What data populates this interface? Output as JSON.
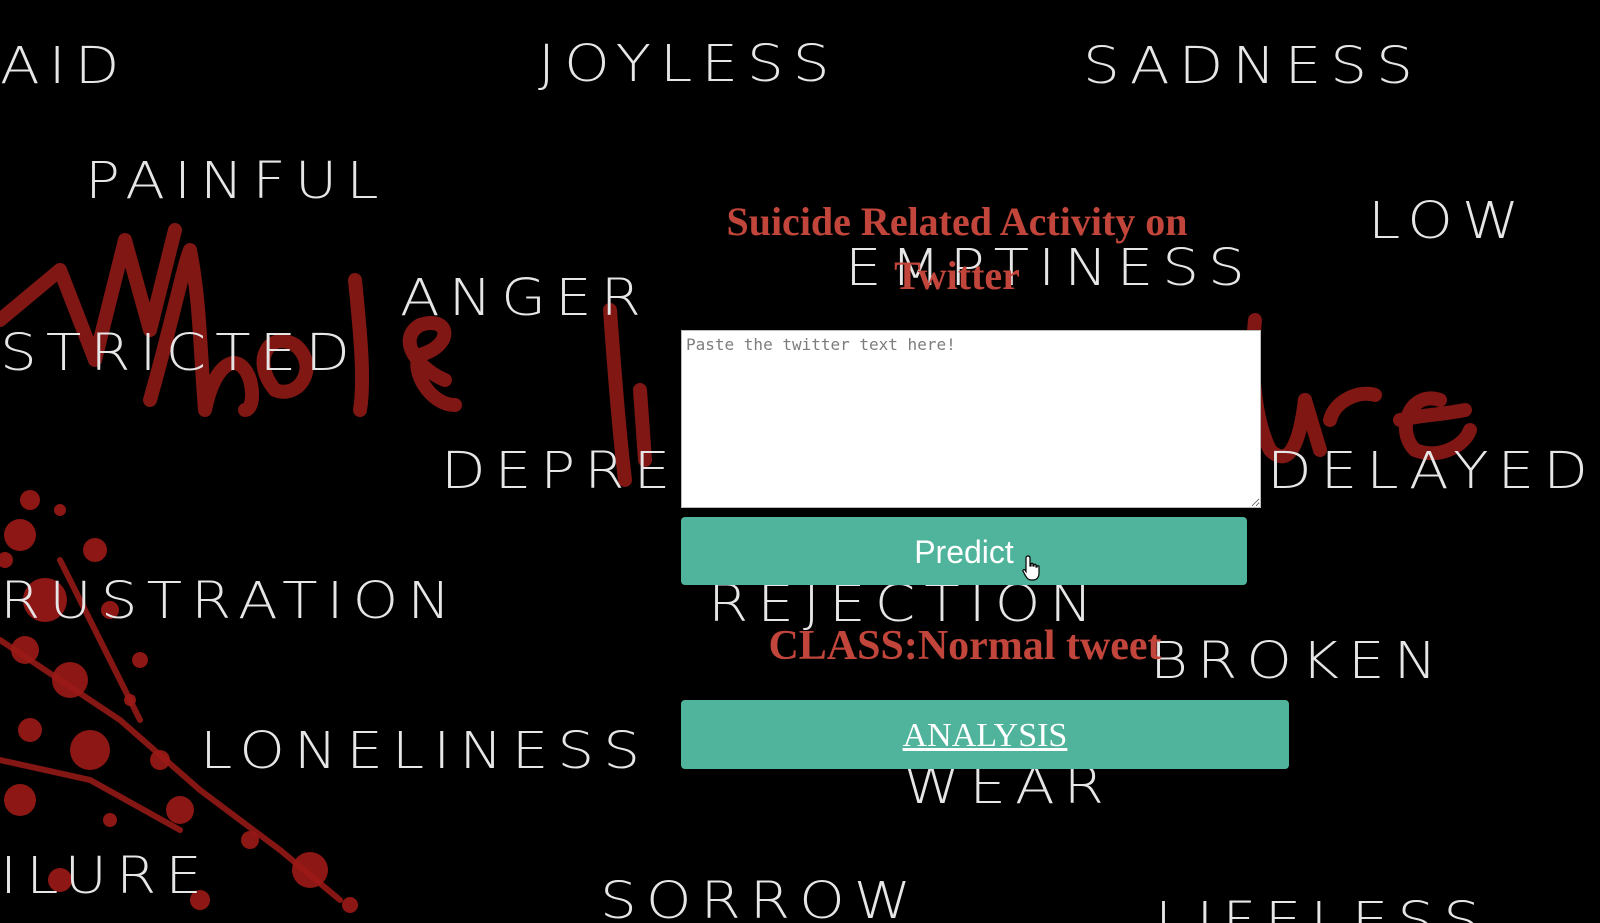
{
  "background_words": [
    "AID",
    "JOYLESS",
    "SADNESS",
    "PAINFUL",
    "LOW",
    "EMPTINESS",
    "ANGER",
    "STRICTED",
    "DEPRES",
    "DELAYED",
    "RUSTRATION",
    "REJECTION",
    "BROKEN",
    "LONELINESS",
    "WEAR",
    "ILURE",
    "SORROW",
    "LIFELESS"
  ],
  "title": "Suicide Related Activity on Twitter",
  "tweet_input": {
    "placeholder": "Paste the twitter text here!",
    "value": ""
  },
  "predict_button_label": "Predict",
  "result_text": "CLASS:Normal tweet",
  "analysis_button_label": "ANALYSIS",
  "colors": {
    "background": "#000000",
    "accent_red": "#c1453a",
    "button_teal": "#4fb49b",
    "word_grey": "#e6e6e6"
  }
}
